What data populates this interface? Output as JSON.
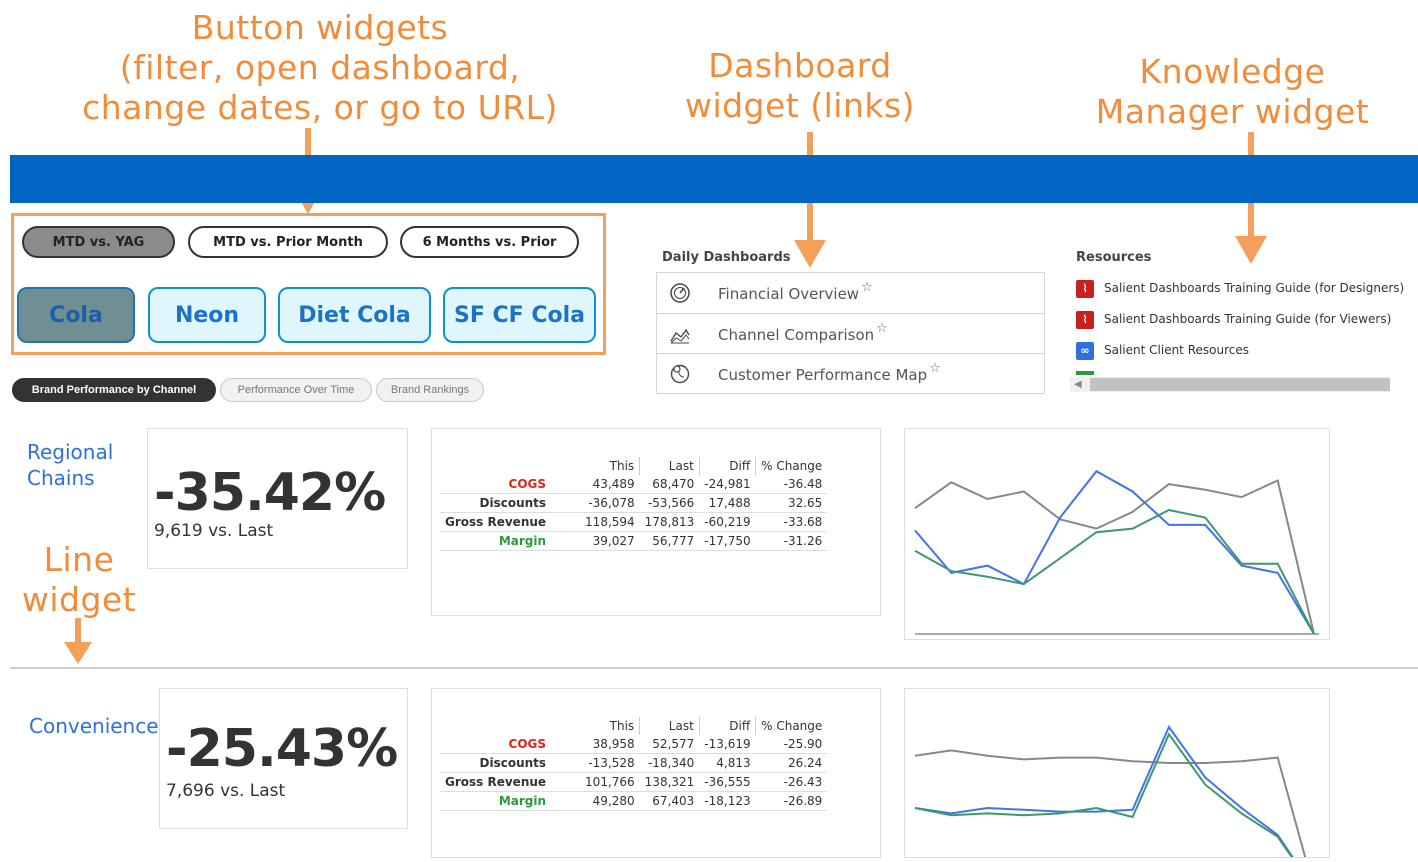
{
  "annotations": {
    "button_widgets": [
      "Button widgets",
      "(filter, open dashboard,",
      "change dates, or go to URL)"
    ],
    "dashboard_widget": [
      "Dashboard",
      "widget (links)"
    ],
    "knowledge_widget": [
      "Knowledge",
      "Manager widget"
    ],
    "line_widget": [
      "Line",
      "widget"
    ]
  },
  "colors": {
    "brand_bar": "#0066c4",
    "callout": "#f28c3a",
    "accent_blue": "#2f6fe0",
    "cogs_red": "#e0231a",
    "margin_green": "#2a9a3a"
  },
  "date_buttons": [
    {
      "label": "MTD vs. YAG",
      "active": true
    },
    {
      "label": "MTD vs. Prior Month",
      "active": false
    },
    {
      "label": "6 Months vs. Prior",
      "active": false
    }
  ],
  "brand_buttons": [
    {
      "label": "Cola",
      "active": true
    },
    {
      "label": "Neon",
      "active": false
    },
    {
      "label": "Diet Cola",
      "active": false
    },
    {
      "label": "SF CF Cola",
      "active": false
    }
  ],
  "tabs": [
    {
      "label": "Brand Performance by Channel",
      "active": true
    },
    {
      "label": "Performance Over Time",
      "active": false
    },
    {
      "label": "Brand Rankings",
      "active": false
    }
  ],
  "daily_dashboards": {
    "title": "Daily Dashboards",
    "items": [
      {
        "label": "Financial Overview",
        "icon": "gauge-icon",
        "star": "☆"
      },
      {
        "label": "Channel Comparison",
        "icon": "area-chart-icon",
        "star": "☆"
      },
      {
        "label": "Customer Performance Map",
        "icon": "globe-pin-icon",
        "star": "☆"
      }
    ]
  },
  "resources": {
    "title": "Resources",
    "items": [
      {
        "label": "Salient Dashboards Training Guide (for Designers)",
        "icon": "pdf-icon"
      },
      {
        "label": "Salient Dashboards Training Guide (for Viewers)",
        "icon": "pdf-icon"
      },
      {
        "label": "Salient Client Resources",
        "icon": "link-icon"
      }
    ]
  },
  "table_headers": [
    "This",
    "Last",
    "Diff",
    "% Change"
  ],
  "sections": [
    {
      "region": [
        "Regional",
        "Chains"
      ],
      "kpi_value": "-35.42%",
      "kpi_sub": "9,619 vs. Last",
      "rows": [
        {
          "label": "COGS",
          "values": [
            "43,489",
            "68,470",
            "-24,981",
            "-36.48"
          ],
          "color": "#e0231a"
        },
        {
          "label": "Discounts",
          "values": [
            "-36,078",
            "-53,566",
            "17,488",
            "32.65"
          ],
          "color": "#333333"
        },
        {
          "label": "Gross Revenue",
          "values": [
            "118,594",
            "178,813",
            "-60,219",
            "-33.68"
          ],
          "color": "#333333"
        },
        {
          "label": "Margin",
          "values": [
            "39,027",
            "56,777",
            "-17,750",
            "-31.26"
          ],
          "color": "#2a9a3a"
        }
      ],
      "chart_data": {
        "type": "line",
        "series": [
          {
            "color": "#888888",
            "values": [
              0.68,
              0.82,
              0.73,
              0.77,
              0.62,
              0.57,
              0.66,
              0.81,
              0.78,
              0.74,
              0.83,
              0.0
            ]
          },
          {
            "color": "#4472ee",
            "values": [
              0.56,
              0.33,
              0.37,
              0.27,
              0.63,
              0.88,
              0.77,
              0.59,
              0.59,
              0.37,
              0.33,
              0.0
            ]
          },
          {
            "color": "#3a9a6a",
            "values": [
              0.45,
              0.34,
              0.31,
              0.27,
              0.41,
              0.55,
              0.57,
              0.67,
              0.63,
              0.38,
              0.38,
              0.0
            ]
          }
        ]
      }
    },
    {
      "region": [
        "Convenience"
      ],
      "kpi_value": "-25.43%",
      "kpi_sub": "7,696 vs. Last",
      "rows": [
        {
          "label": "COGS",
          "values": [
            "38,958",
            "52,577",
            "-13,619",
            "-25.90"
          ],
          "color": "#e0231a"
        },
        {
          "label": "Discounts",
          "values": [
            "-13,528",
            "-18,340",
            "4,813",
            "26.24"
          ],
          "color": "#333333"
        },
        {
          "label": "Gross Revenue",
          "values": [
            "101,766",
            "138,321",
            "-36,555",
            "-26.43"
          ],
          "color": "#333333"
        },
        {
          "label": "Margin",
          "values": [
            "49,280",
            "67,403",
            "-18,123",
            "-26.89"
          ],
          "color": "#2a9a3a"
        }
      ],
      "chart_data": {
        "type": "line",
        "series": [
          {
            "color": "#888888",
            "values": [
              0.74,
              0.77,
              0.74,
              0.72,
              0.73,
              0.73,
              0.71,
              0.7,
              0.7,
              0.71,
              0.73,
              0.0
            ]
          },
          {
            "color": "#4472ee",
            "values": [
              0.45,
              0.42,
              0.45,
              0.44,
              0.43,
              0.43,
              0.44,
              0.9,
              0.62,
              0.45,
              0.3,
              0.0
            ]
          },
          {
            "color": "#3a9a6a",
            "values": [
              0.45,
              0.41,
              0.42,
              0.41,
              0.42,
              0.45,
              0.4,
              0.86,
              0.58,
              0.42,
              0.29,
              0.0
            ]
          }
        ]
      }
    }
  ]
}
